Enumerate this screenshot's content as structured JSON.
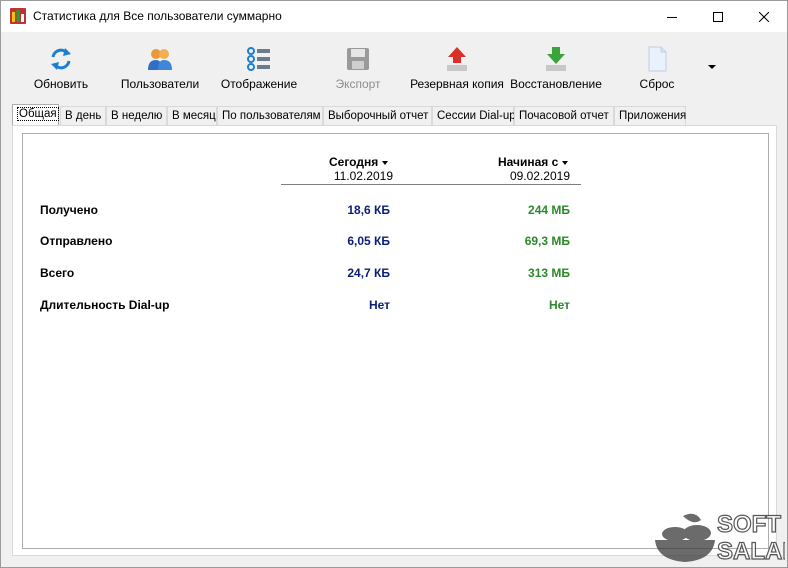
{
  "window": {
    "title": "Статистика для Все пользователи суммарно"
  },
  "toolbar": {
    "refresh": "Обновить",
    "users": "Пользователи",
    "display": "Отображение",
    "export": "Экспорт",
    "backup": "Резервная копия",
    "restore": "Восстановление",
    "reset": "Сброс"
  },
  "tabs": [
    "Общая",
    "В день",
    "В неделю",
    "В месяц",
    "По пользователям",
    "Выборочный отчет",
    "Сессии Dial-up",
    "Почасовой отчет",
    "Приложения"
  ],
  "summary": {
    "col_today": "Сегодня",
    "col_since": "Начиная с",
    "date_today": "11.02.2019",
    "date_since": "09.02.2019",
    "rows": [
      {
        "label": "Получено",
        "today": "18,6 КБ",
        "since": "244 МБ"
      },
      {
        "label": "Отправлено",
        "today": "6,05 КБ",
        "since": "69,3 МБ"
      },
      {
        "label": "Всего",
        "today": "24,7 КБ",
        "since": "313 МБ"
      },
      {
        "label": "Длительность Dial-up",
        "today": "Нет",
        "since": "Нет"
      }
    ]
  },
  "colors": {
    "today_value": "#0b1e7a",
    "since_value": "#2b8a2b"
  },
  "watermark": {
    "line1": "SOFT",
    "line2": "SALAD"
  }
}
